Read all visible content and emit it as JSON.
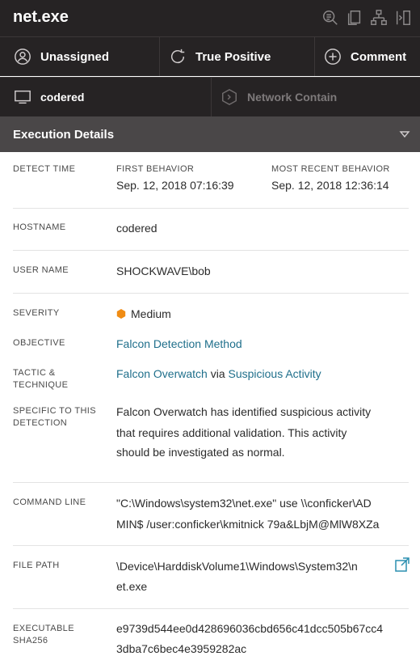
{
  "header": {
    "title": "net.exe",
    "icons": [
      "search-list-icon",
      "copy-pages-icon",
      "process-tree-icon",
      "panel-collapse-icon"
    ]
  },
  "actions": {
    "assign_label": "Unassigned",
    "status_label": "True Positive",
    "comment_label": "Comment",
    "host_label": "codered",
    "contain_label": "Network Contain"
  },
  "section": {
    "title": "Execution Details"
  },
  "details": {
    "detect_time_label": "DETECT TIME",
    "first_behavior_label": "FIRST BEHAVIOR",
    "first_behavior": "Sep. 12, 2018 07:16:39",
    "recent_behavior_label": "MOST RECENT BEHAVIOR",
    "recent_behavior": "Sep. 12, 2018 12:36:14",
    "hostname_label": "HOSTNAME",
    "hostname": "codered",
    "username_label": "USER NAME",
    "username": "SHOCKWAVE\\bob",
    "severity_label": "SEVERITY",
    "severity": "Medium",
    "severity_color": "#f08c14",
    "objective_label": "OBJECTIVE",
    "objective": "Falcon Detection Method",
    "tactic_label_1": "TACTIC &",
    "tactic_label_2": "TECHNIQUE",
    "tactic": "Falcon Overwatch",
    "tactic_via": "via",
    "technique": "Suspicious Activity",
    "specific_label_1": "SPECIFIC TO THIS",
    "specific_label_2": "DETECTION",
    "specific_line_1": "Falcon Overwatch has identified suspicious activity",
    "specific_line_2": "that requires additional validation. This activity",
    "specific_line_3": "should be investigated as normal.",
    "cmdline_label": "COMMAND LINE",
    "cmdline_1": "\"C:\\Windows\\system32\\net.exe\" use \\\\conficker\\AD",
    "cmdline_2": "MIN$ /user:conficker\\kmitnick 79a&LbjM@MlW8XZa",
    "filepath_label": "FILE PATH",
    "filepath_1": "\\Device\\HarddiskVolume1\\Windows\\System32\\n",
    "filepath_2": "et.exe",
    "sha_label_1": "EXECUTABLE",
    "sha_label_2": "SHA256",
    "sha_1": "e9739d544ee0d428696036cbd656c41dcc505b67cc4",
    "sha_2": "3dba7c6bec4e3959282ac"
  },
  "colors": {
    "header_bg": "#262324",
    "section_bg": "#4a4748",
    "link": "#1f6f8b",
    "copy_icon": "#2a8fb0"
  }
}
